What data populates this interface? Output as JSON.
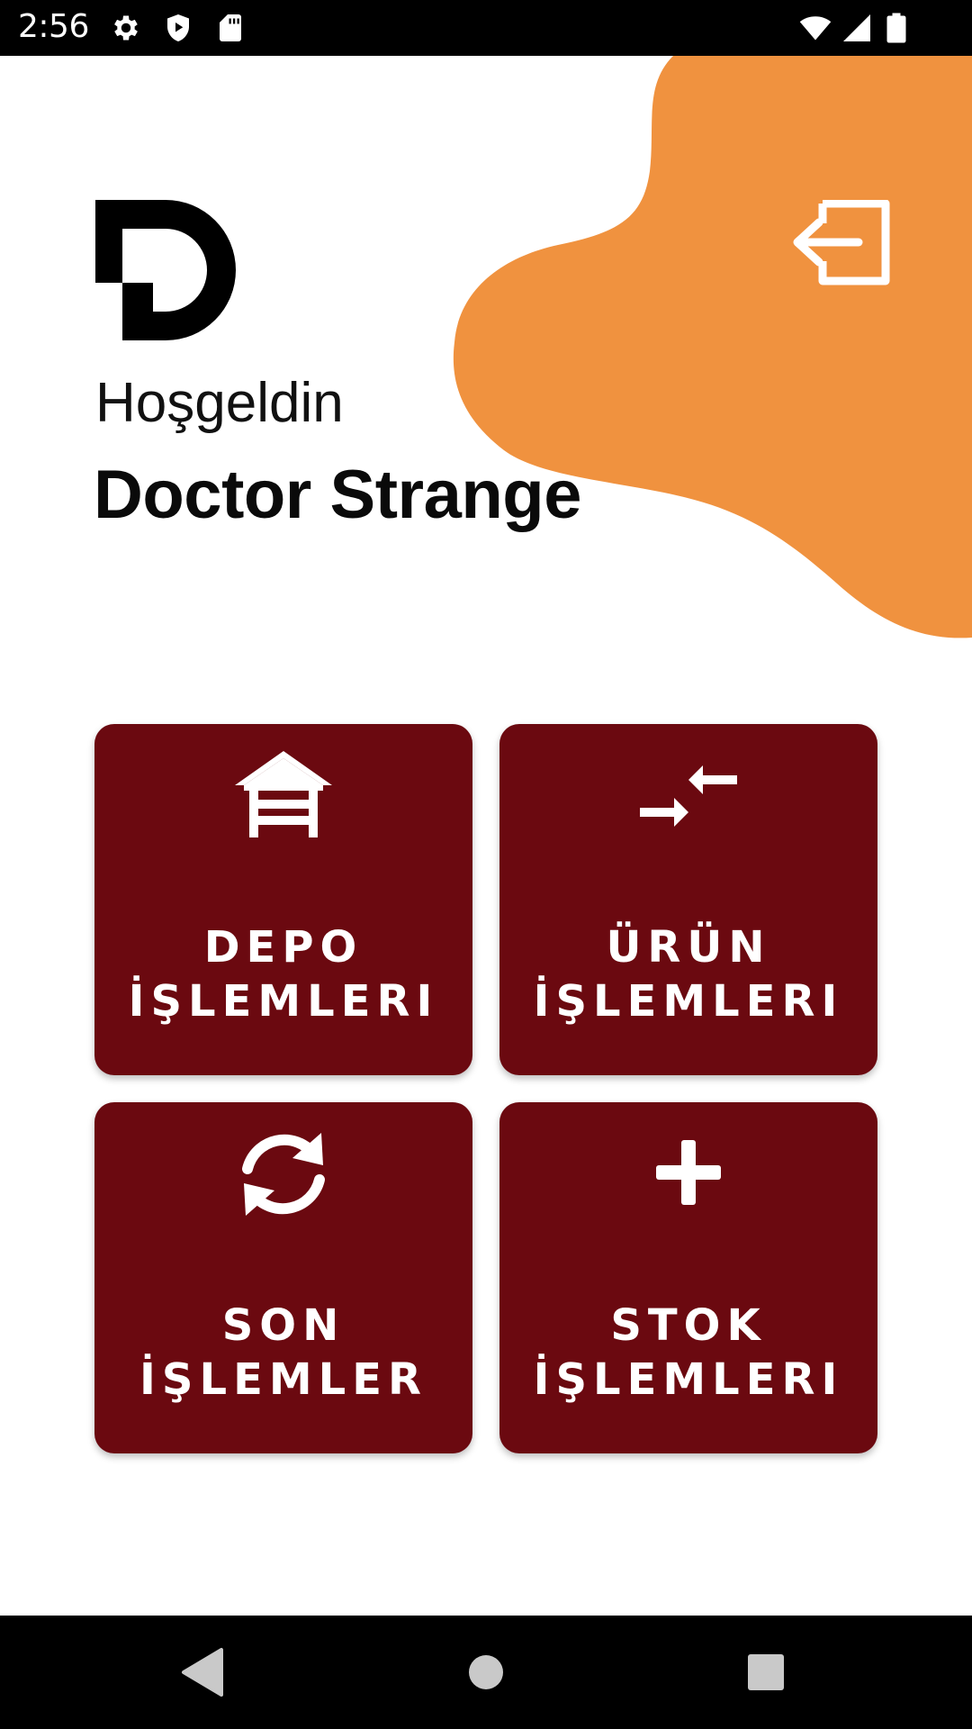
{
  "status_bar": {
    "time": "2:56",
    "left_icons": [
      "settings-icon",
      "shield-play-icon",
      "sd-card-icon"
    ],
    "right_icons": [
      "wifi-icon",
      "signal-icon",
      "battery-icon"
    ]
  },
  "header": {
    "greeting": "Hoşgeldin",
    "user_name": "Doctor Strange",
    "logo_icon": "d-logo-icon",
    "logout_icon": "logout-icon"
  },
  "colors": {
    "accent_orange": "#F0923F",
    "tile_background": "#6B0910",
    "tile_text": "#FFFFFF"
  },
  "tiles": [
    {
      "icon": "warehouse-icon",
      "line1": "DEPO",
      "line2": "İŞLEMLERI"
    },
    {
      "icon": "compare-arrows-icon",
      "line1": "ÜRÜN",
      "line2": "İŞLEMLERI"
    },
    {
      "icon": "refresh-icon",
      "line1": "SON",
      "line2": "İŞLEMLER"
    },
    {
      "icon": "plus-icon",
      "line1": "STOK",
      "line2": "İŞLEMLERI"
    }
  ],
  "nav_bar": {
    "buttons": [
      "back-icon",
      "home-icon",
      "recents-icon"
    ]
  }
}
